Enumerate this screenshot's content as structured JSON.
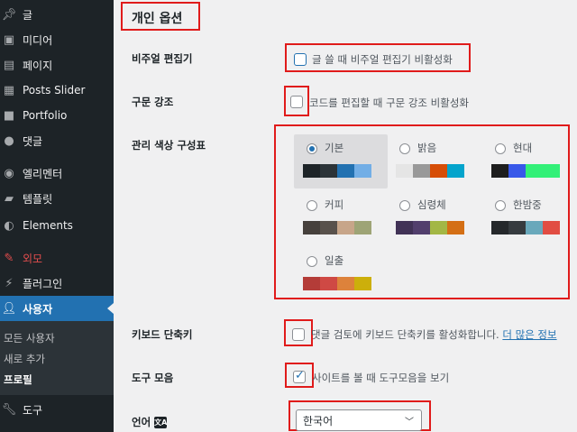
{
  "sidebar": {
    "items": [
      {
        "label": "글",
        "icon": "pin-icon"
      },
      {
        "label": "미디어",
        "icon": "media-icon"
      },
      {
        "label": "페이지",
        "icon": "page-icon"
      },
      {
        "label": "Posts Slider",
        "icon": "slider-icon"
      },
      {
        "label": "Portfolio",
        "icon": "folder-icon"
      },
      {
        "label": "댓글",
        "icon": "comment-icon"
      },
      {
        "label": "엘리멘터",
        "icon": "elementor-icon"
      },
      {
        "label": "템플릿",
        "icon": "template-folder-icon"
      },
      {
        "label": "Elements",
        "icon": "elements-icon"
      },
      {
        "label": "외모",
        "icon": "brush-icon"
      },
      {
        "label": "플러그인",
        "icon": "plugin-icon"
      },
      {
        "label": "사용자",
        "icon": "user-icon"
      },
      {
        "label": "도구",
        "icon": "wrench-icon"
      }
    ],
    "submenu": [
      "모든 사용자",
      "새로 추가",
      "프로필"
    ]
  },
  "main": {
    "heading": "개인 옵션",
    "visual_editor": {
      "label": "비주얼 편집기",
      "option": "글 쓸 때 비주얼 편집기 비활성화"
    },
    "syntax": {
      "label": "구문 강조",
      "option": "코드를 편집할 때 구문 강조 비활성화"
    },
    "color_scheme": {
      "label": "관리 색상 구성표",
      "schemes": [
        {
          "name": "기본",
          "selected": true,
          "colors": [
            "#1d2327",
            "#2c3338",
            "#2271b1",
            "#72aee6"
          ]
        },
        {
          "name": "밝음",
          "selected": false,
          "colors": [
            "#e5e5e5",
            "#999999",
            "#d64e07",
            "#04a4cc"
          ]
        },
        {
          "name": "현대",
          "selected": false,
          "colors": [
            "#1e1e1e",
            "#3858e9",
            "#33f078",
            "#33f078"
          ]
        },
        {
          "name": "커피",
          "selected": false,
          "colors": [
            "#46403c",
            "#59524c",
            "#c7a589",
            "#9ea476"
          ]
        },
        {
          "name": "심령체",
          "selected": false,
          "colors": [
            "#413256",
            "#523f6d",
            "#a3b745",
            "#d46f15"
          ]
        },
        {
          "name": "한밤중",
          "selected": false,
          "colors": [
            "#25282b",
            "#363b3f",
            "#69a8bb",
            "#e14d43"
          ]
        },
        {
          "name": "일출",
          "selected": false,
          "colors": [
            "#b43c38",
            "#cf4944",
            "#dd823b",
            "#ccaf0b"
          ]
        }
      ]
    },
    "shortcuts": {
      "label": "키보드 단축키",
      "option": "댓글 검토에 키보드 단축키를 활성화합니다.",
      "link": "더 많은 정보"
    },
    "toolbar": {
      "label": "도구 모음",
      "option": "사이트를 볼 때 도구모음을 보기",
      "checked": true
    },
    "language": {
      "label": "언어",
      "icon_text": "文A",
      "value": "한국어"
    }
  }
}
